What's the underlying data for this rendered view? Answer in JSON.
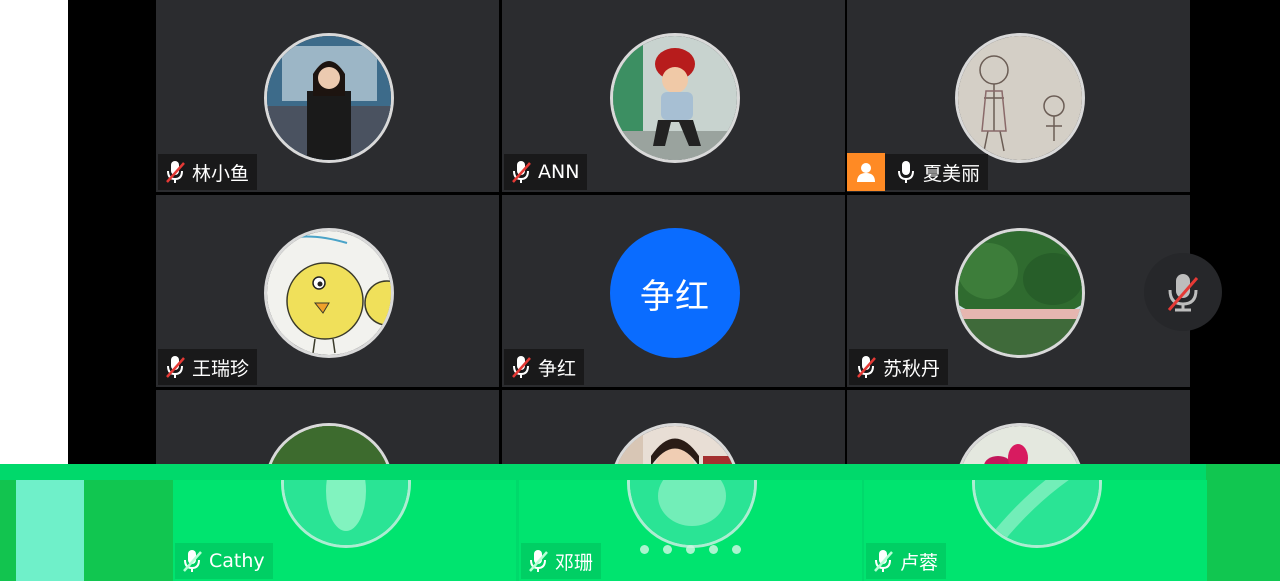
{
  "participants": [
    {
      "name": "林小鱼",
      "muted": true
    },
    {
      "name": "ANN",
      "muted": true
    },
    {
      "name": "夏美丽",
      "muted": false,
      "host": true
    },
    {
      "name": "王瑞珍",
      "muted": true
    },
    {
      "name": "争红",
      "muted": true,
      "initials": "争红"
    },
    {
      "name": "苏秋丹",
      "muted": true
    },
    {
      "name": "Cathy",
      "muted": true
    },
    {
      "name": "邓珊",
      "muted": true
    },
    {
      "name": "卢蓉",
      "muted": true
    }
  ],
  "icons": {
    "mic_muted": "mic-muted-icon",
    "mic_on": "mic-icon",
    "host": "host-person-icon",
    "floating_mic": "mic-muted-icon"
  },
  "colors": {
    "tile_bg": "#2b2c2f",
    "avatar_blue": "#0a6cff",
    "host_orange": "#ff8a24",
    "overlay_green": "#00d96b",
    "muted_red": "#e53935"
  },
  "pager": {
    "page_count": 5
  }
}
